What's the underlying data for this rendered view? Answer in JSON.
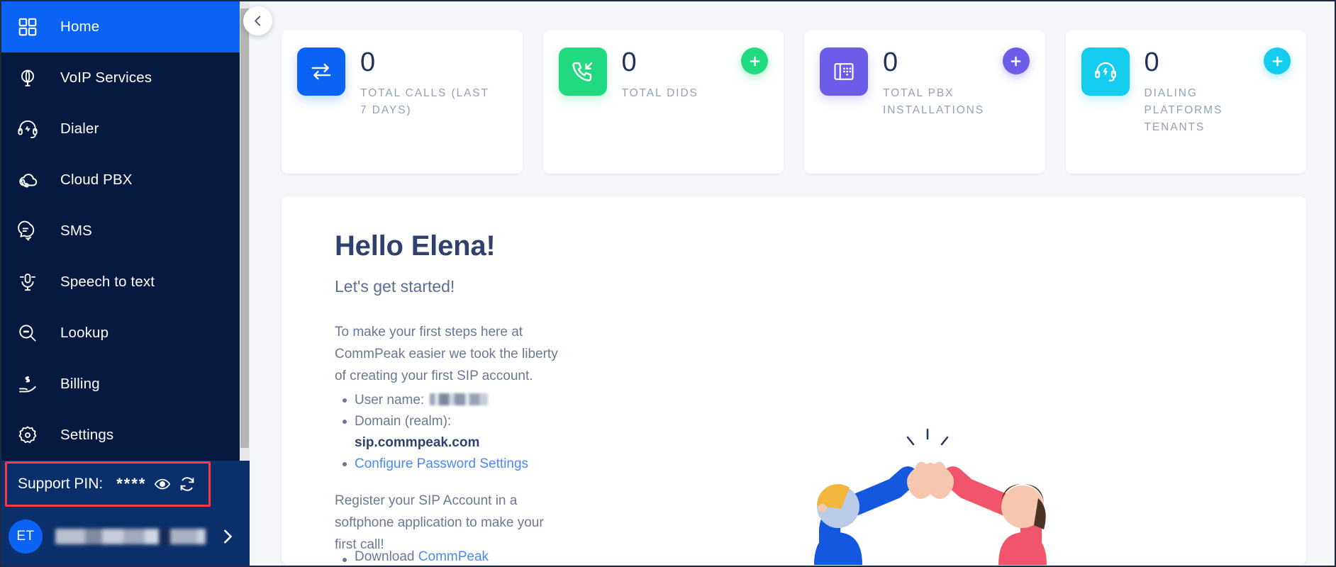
{
  "sidebar": {
    "items": [
      {
        "label": "Home",
        "icon": "grid-icon",
        "active": true
      },
      {
        "label": "VoIP Services",
        "icon": "globe-icon",
        "active": false
      },
      {
        "label": "Dialer",
        "icon": "headset-icon",
        "active": false
      },
      {
        "label": "Cloud PBX",
        "icon": "cloud-phone-icon",
        "active": false
      },
      {
        "label": "SMS",
        "icon": "chat-icon",
        "active": false
      },
      {
        "label": "Speech to text",
        "icon": "microphone-icon",
        "active": false
      },
      {
        "label": "Lookup",
        "icon": "magnifier-icon",
        "active": false
      },
      {
        "label": "Billing",
        "icon": "hand-money-icon",
        "active": false
      },
      {
        "label": "Settings",
        "icon": "gear-icon",
        "active": false
      }
    ],
    "support": {
      "label": "Support PIN:",
      "pin_masked": "****",
      "eye_icon": "eye-icon",
      "refresh_icon": "refresh-icon",
      "highlight_color": "#fa3c3c"
    },
    "user": {
      "initials": "ET",
      "name_redacted": "",
      "chevron_icon": "chevron-right-icon"
    },
    "collapse_icon": "chevron-left-icon",
    "background_color": "#061a3f",
    "active_color": "#0b63f6"
  },
  "stats": [
    {
      "value": "0",
      "label": "TOTAL CALLS (LAST 7 DAYS)",
      "icon": "transfer-arrows-icon",
      "color": "#0b63f6",
      "tone": "blue",
      "has_add": false,
      "add_icon": ""
    },
    {
      "value": "0",
      "label": "TOTAL DIDS",
      "icon": "incoming-call-icon",
      "color": "#21d97f",
      "tone": "green",
      "has_add": true,
      "add_icon": "plus-icon"
    },
    {
      "value": "0",
      "label": "TOTAL PBX INSTALLATIONS",
      "icon": "desk-phone-icon",
      "color": "#6c5ce7",
      "tone": "purple",
      "has_add": true,
      "add_icon": "plus-icon"
    },
    {
      "value": "0",
      "label": "DIALING PLATFORMS TENANTS",
      "icon": "headset-bolt-icon",
      "color": "#14cdee",
      "tone": "cyan",
      "has_add": true,
      "add_icon": "plus-icon"
    }
  ],
  "welcome": {
    "title": "Hello Elena!",
    "subtitle": "Let's get started!",
    "intro": "To make your first steps here at CommPeak easier we took the liberty of creating your first SIP account.",
    "list": {
      "username_label": "User name:",
      "username_value": "",
      "domain_label": "Domain (realm):",
      "domain_value": "sip.commpeak.com",
      "configure_link": "Configure Password Settings"
    },
    "register_text": "Register your SIP Account in a softphone application to make your first call!",
    "download_prefix": "Download",
    "download_link": "CommPeak"
  }
}
